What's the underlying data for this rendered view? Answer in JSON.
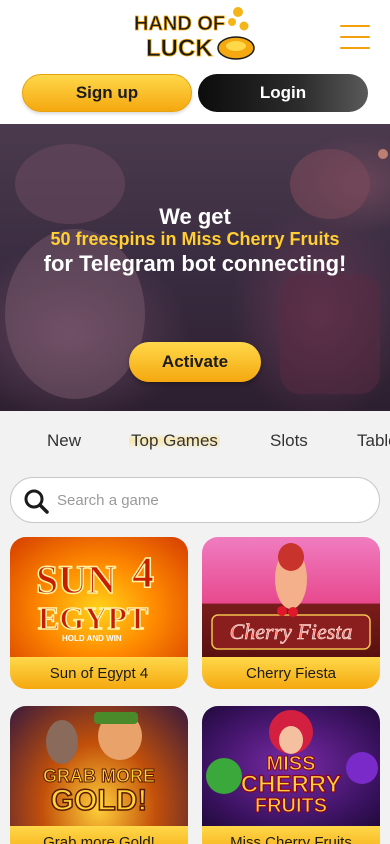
{
  "header": {
    "logo_line1": "HAND OF",
    "logo_line2": "LUCK",
    "menu_icon": "hamburger-menu-icon"
  },
  "auth": {
    "signup_label": "Sign up",
    "login_label": "Login"
  },
  "banner": {
    "line1": "We get",
    "line2": "50 freespins in Miss Cherry Fruits",
    "line3": "for Telegram bot connecting!",
    "cta_label": "Activate"
  },
  "tabs": [
    {
      "label": "New",
      "active": false
    },
    {
      "label": "Top Games",
      "active": true
    },
    {
      "label": "Slots",
      "active": false
    },
    {
      "label": "Table",
      "active": false
    }
  ],
  "search": {
    "placeholder": "Search a game",
    "value": ""
  },
  "games": [
    {
      "title": "Sun of Egypt 4",
      "art_line1": "SUN",
      "art_number": "4",
      "art_line2": "EGYPT",
      "art_tag": "HOLD AND WIN"
    },
    {
      "title": "Cherry Fiesta",
      "art_line1": "Cherry Fiesta"
    },
    {
      "title": "Grab more Gold!",
      "art_line1": "GRAB MORE",
      "art_line2": "GOLD!"
    },
    {
      "title": "Miss Cherry Fruits",
      "art_line1": "MISS",
      "art_line2": "CHERRY",
      "art_line3": "FRUITS"
    }
  ],
  "colors": {
    "accent_yellow": "#f5a80f",
    "accent_light": "#ffd84a",
    "dark_button": "#0c0c0c"
  }
}
